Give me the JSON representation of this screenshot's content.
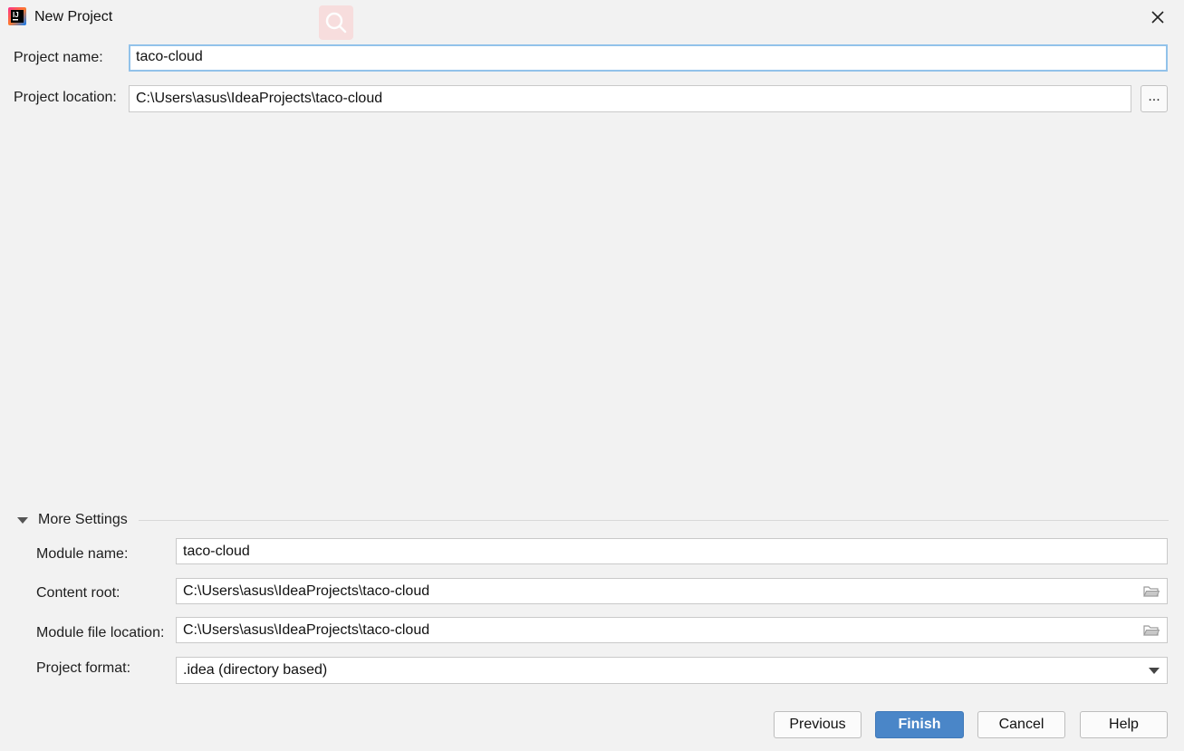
{
  "window": {
    "title": "New Project",
    "app_icon": "intellij-idea-icon",
    "close_icon": "close-icon"
  },
  "top": {
    "project_name_label": "Project name:",
    "project_name_value": "taco-cloud",
    "project_location_label": "Project location:",
    "project_location_value": "C:\\Users\\asus\\IdeaProjects\\taco-cloud",
    "browse_label": "..."
  },
  "more_settings": {
    "toggle_label": "More Settings",
    "expanded": true,
    "module_name_label": "Module name:",
    "module_name_value": "taco-cloud",
    "content_root_label": "Content root:",
    "content_root_value": "C:\\Users\\asus\\IdeaProjects\\taco-cloud",
    "module_file_location_label": "Module file location:",
    "module_file_location_value": "C:\\Users\\asus\\IdeaProjects\\taco-cloud",
    "project_format_label": "Project format:",
    "project_format_value": ".idea (directory based)"
  },
  "buttons": {
    "previous": "Previous",
    "finish": "Finish",
    "cancel": "Cancel",
    "help": "Help"
  },
  "colors": {
    "background": "#f2f2f2",
    "focus_border": "#92c2ea",
    "primary_button": "#4a86c8"
  }
}
